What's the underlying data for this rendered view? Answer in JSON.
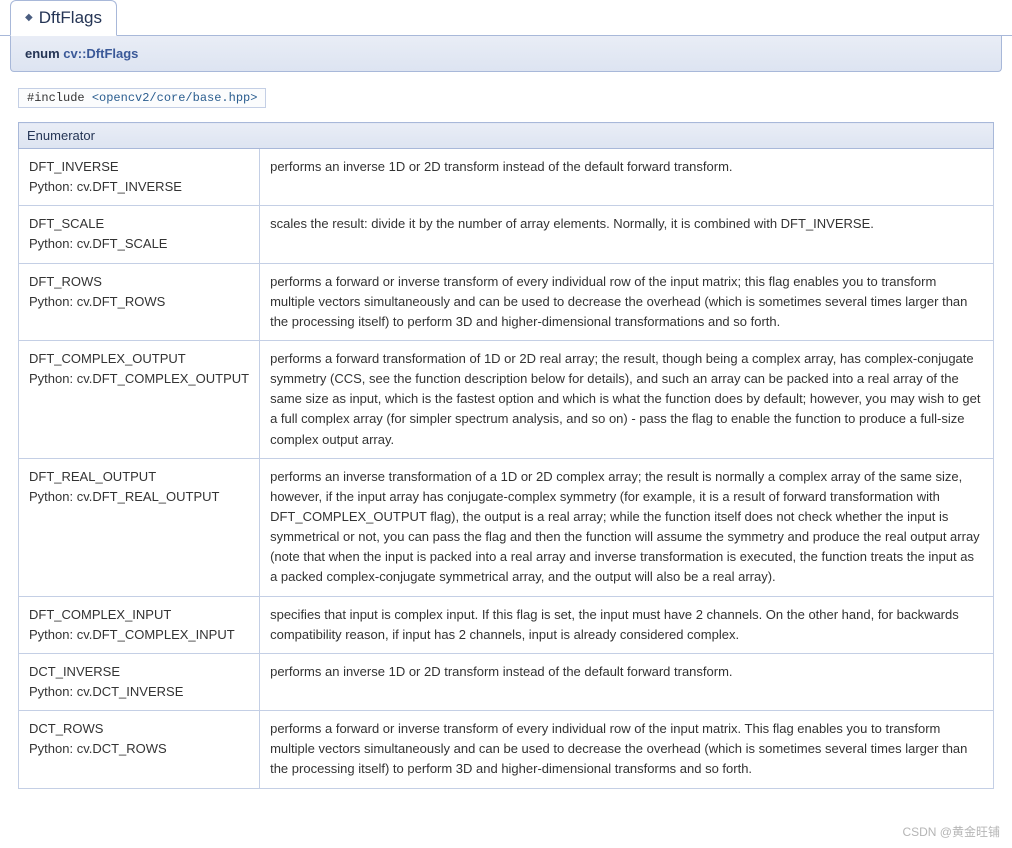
{
  "tab": {
    "title": "DftFlags"
  },
  "memname": {
    "prefix": "enum ",
    "link": "cv::DftFlags"
  },
  "include": {
    "prefix": "#include ",
    "open": "<",
    "path": "opencv2/core/base.hpp",
    "close": ">"
  },
  "table": {
    "header": "Enumerator",
    "rows": [
      {
        "name": "DFT_INVERSE",
        "python": "Python: cv.DFT_INVERSE",
        "desc": "performs an inverse 1D or 2D transform instead of the default forward transform."
      },
      {
        "name": "DFT_SCALE",
        "python": "Python: cv.DFT_SCALE",
        "desc": "scales the result: divide it by the number of array elements. Normally, it is combined with DFT_INVERSE."
      },
      {
        "name": "DFT_ROWS",
        "python": "Python: cv.DFT_ROWS",
        "desc": "performs a forward or inverse transform of every individual row of the input matrix; this flag enables you to transform multiple vectors simultaneously and can be used to decrease the overhead (which is sometimes several times larger than the processing itself) to perform 3D and higher-dimensional transformations and so forth."
      },
      {
        "name": "DFT_COMPLEX_OUTPUT",
        "python": "Python: cv.DFT_COMPLEX_OUTPUT",
        "desc": "performs a forward transformation of 1D or 2D real array; the result, though being a complex array, has complex-conjugate symmetry (CCS, see the function description below for details), and such an array can be packed into a real array of the same size as input, which is the fastest option and which is what the function does by default; however, you may wish to get a full complex array (for simpler spectrum analysis, and so on) - pass the flag to enable the function to produce a full-size complex output array."
      },
      {
        "name": "DFT_REAL_OUTPUT",
        "python": "Python: cv.DFT_REAL_OUTPUT",
        "desc": "performs an inverse transformation of a 1D or 2D complex array; the result is normally a complex array of the same size, however, if the input array has conjugate-complex symmetry (for example, it is a result of forward transformation with DFT_COMPLEX_OUTPUT flag), the output is a real array; while the function itself does not check whether the input is symmetrical or not, you can pass the flag and then the function will assume the symmetry and produce the real output array (note that when the input is packed into a real array and inverse transformation is executed, the function treats the input as a packed complex-conjugate symmetrical array, and the output will also be a real array)."
      },
      {
        "name": "DFT_COMPLEX_INPUT",
        "python": "Python: cv.DFT_COMPLEX_INPUT",
        "desc": "specifies that input is complex input. If this flag is set, the input must have 2 channels. On the other hand, for backwards compatibility reason, if input has 2 channels, input is already considered complex."
      },
      {
        "name": "DCT_INVERSE",
        "python": "Python: cv.DCT_INVERSE",
        "desc": "performs an inverse 1D or 2D transform instead of the default forward transform."
      },
      {
        "name": "DCT_ROWS",
        "python": "Python: cv.DCT_ROWS",
        "desc": "performs a forward or inverse transform of every individual row of the input matrix. This flag enables you to transform multiple vectors simultaneously and can be used to decrease the overhead (which is sometimes several times larger than the processing itself) to perform 3D and higher-dimensional transforms and so forth."
      }
    ]
  },
  "watermark": "CSDN @黄金旺铺"
}
